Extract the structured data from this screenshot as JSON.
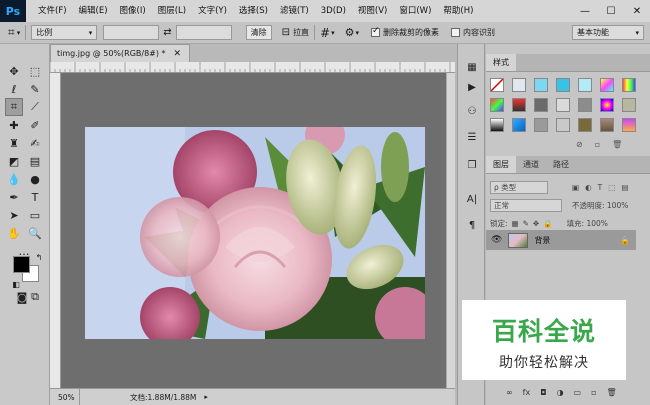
{
  "app": {
    "logo": "Ps",
    "menu": [
      "文件(F)",
      "编辑(E)",
      "图像(I)",
      "图层(L)",
      "文字(Y)",
      "选择(S)",
      "滤镜(T)",
      "3D(D)",
      "视图(V)",
      "窗口(W)",
      "帮助(H)"
    ],
    "window_controls": [
      "—",
      "☐",
      "✕"
    ]
  },
  "options": {
    "ratio_select": "比例",
    "clear_button": "清除",
    "straighten_label": "拉直",
    "delete_cropped_label": "删除裁剪的像素",
    "delete_cropped_checked": true,
    "content_aware_label": "内容识别",
    "content_aware_checked": false,
    "workspace_select": "基本功能"
  },
  "document": {
    "tab_title": "timg.jpg @ 50%(RGB/8#) *",
    "ruler_marks": [
      "-1050",
      "-100",
      "-50",
      "0",
      "50",
      "100",
      "150",
      "200",
      "250",
      "300",
      "350",
      "400",
      "450",
      "500",
      "550",
      "600",
      "650",
      "700",
      "750",
      "800"
    ],
    "zoom": "50%",
    "doc_info": "文档:1.88M/1.88M"
  },
  "styles_panel": {
    "tab": "样式"
  },
  "layers_panel": {
    "tabs": [
      "图层",
      "通道",
      "路径"
    ],
    "filter_label": "ρ 类型",
    "blend_mode": "正常",
    "opacity_label": "不透明度: 100%",
    "lock_label": "锁定:",
    "fill_label": "填充: 100%",
    "layer_name": "背景"
  },
  "watermark": {
    "title": "百科全说",
    "subtitle": "助你轻松解决"
  },
  "colors": {
    "accent": "#31a8ff",
    "watermark_green": "#3aa84a"
  }
}
